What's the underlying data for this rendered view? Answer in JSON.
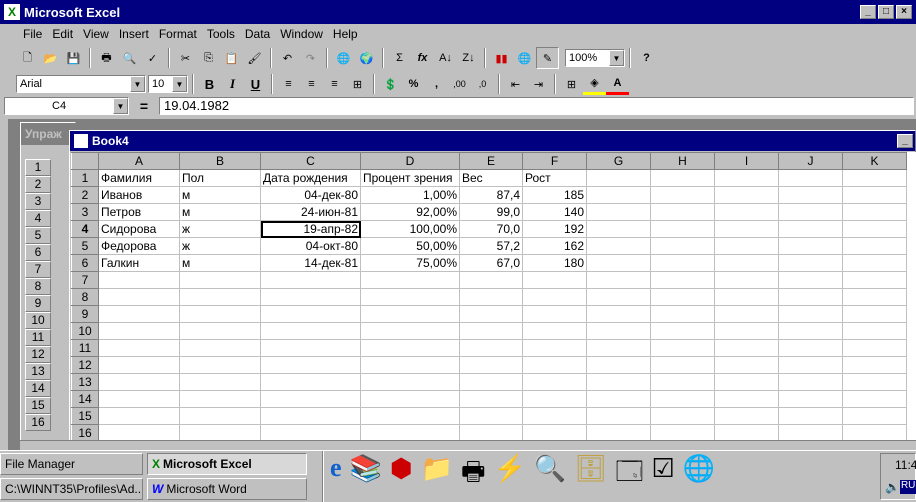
{
  "app": {
    "title": "Microsoft Excel"
  },
  "menu": [
    "File",
    "Edit",
    "View",
    "Insert",
    "Format",
    "Tools",
    "Data",
    "Window",
    "Help"
  ],
  "toolbar": {
    "zoom": "100%",
    "font": "Arial",
    "size": "10",
    "bold": "B",
    "italic": "I",
    "underline": "U",
    "sigma": "Σ",
    "fx": "fx",
    "percent": "%",
    "comma": ",",
    "inc_dec": ",00",
    "dec_dec": ",0",
    "underline_a": "A"
  },
  "formula_bar": {
    "name_box": "C4",
    "equals": "=",
    "content": "19.04.1982"
  },
  "back_window": {
    "title": "Упраж",
    "rows": [
      "1",
      "2",
      "3",
      "4",
      "5",
      "6",
      "7",
      "8",
      "9",
      "10",
      "11",
      "12",
      "13",
      "14",
      "15",
      "16"
    ]
  },
  "workbook": {
    "title": "Book4",
    "columns": [
      "A",
      "B",
      "C",
      "D",
      "E",
      "F",
      "G",
      "H",
      "I",
      "J",
      "K"
    ],
    "rows": [
      {
        "n": "1",
        "cells": [
          "Фамилия",
          "Пол",
          "Дата рождения",
          "Процент зрения",
          "Вес",
          "Рост"
        ]
      },
      {
        "n": "2",
        "cells": [
          "Иванов",
          "м",
          "04-дек-80",
          "1,00%",
          "87,4",
          "185"
        ]
      },
      {
        "n": "3",
        "cells": [
          "Петров",
          "м",
          "24-июн-81",
          "92,00%",
          "99,0",
          "140"
        ]
      },
      {
        "n": "4",
        "cells": [
          "Сидорова",
          "ж",
          "19-апр-82",
          "100,00%",
          "70,0",
          "192"
        ]
      },
      {
        "n": "5",
        "cells": [
          "Федорова",
          "ж",
          "04-окт-80",
          "50,00%",
          "57,2",
          "162"
        ]
      },
      {
        "n": "6",
        "cells": [
          "Галкин",
          "м",
          "14-дек-81",
          "75,00%",
          "67,0",
          "180"
        ]
      },
      {
        "n": "7",
        "cells": []
      },
      {
        "n": "8",
        "cells": []
      },
      {
        "n": "9",
        "cells": []
      },
      {
        "n": "10",
        "cells": []
      },
      {
        "n": "11",
        "cells": []
      },
      {
        "n": "12",
        "cells": []
      },
      {
        "n": "13",
        "cells": []
      },
      {
        "n": "14",
        "cells": []
      },
      {
        "n": "15",
        "cells": []
      },
      {
        "n": "16",
        "cells": []
      }
    ]
  },
  "taskbar": {
    "buttons": [
      "File Manager",
      "Microsoft Excel",
      "C:\\WINNT35\\Profiles\\Ad...",
      "Microsoft Word"
    ],
    "clock": "11:4",
    "lang": "RU"
  }
}
